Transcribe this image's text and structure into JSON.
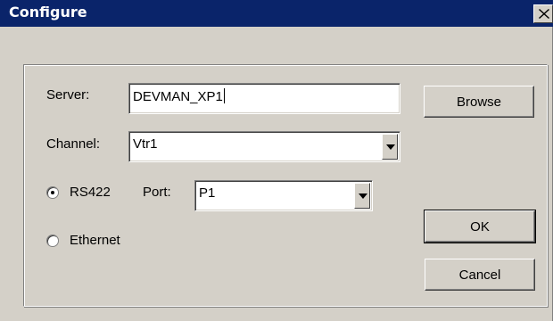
{
  "window": {
    "title": "Configure",
    "close_icon": "close-icon"
  },
  "server": {
    "label": "Server:",
    "value": "DEVMAN_XP1",
    "browse_label": "Browse"
  },
  "channel": {
    "label": "Channel:",
    "value": "Vtr1"
  },
  "connection": {
    "rs422_label": "RS422",
    "rs422_checked": true,
    "port_label": "Port:",
    "port_value": "P1",
    "ethernet_label": "Ethernet",
    "ethernet_checked": false
  },
  "buttons": {
    "ok_label": "OK",
    "cancel_label": "Cancel"
  },
  "colors": {
    "titlebar": "#0a246a",
    "face": "#d4d0c8"
  }
}
